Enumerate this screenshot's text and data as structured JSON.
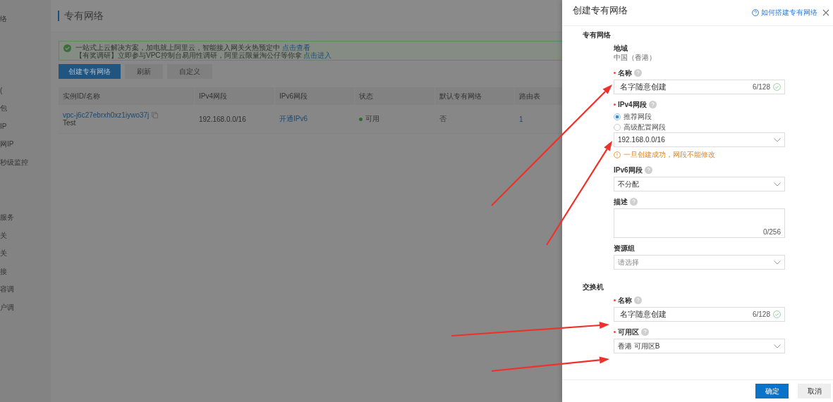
{
  "sidebar": {
    "items": [
      {
        "label": "络"
      },
      {
        "label": "("
      },
      {
        "label": "包"
      },
      {
        "label": "IP"
      },
      {
        "label": "网IP"
      },
      {
        "label": "秒级监控"
      },
      {
        "label": "服务"
      },
      {
        "label": "关"
      },
      {
        "label": "关"
      },
      {
        "label": "接"
      },
      {
        "label": "容调"
      },
      {
        "label": "户调"
      }
    ]
  },
  "page": {
    "title": "专有网络",
    "notices": [
      {
        "text": "一站式上云解决方案，加电就上阿里云，智能接入网关火热预定中",
        "link": "点击查看"
      },
      {
        "text": "【有奖调研】立即参与VPC控制台易用性调研，阿里云限量淘公仔等你拿",
        "link": "点击进入"
      }
    ],
    "buttons": [
      {
        "label": "创建专有网络",
        "kind": "primary"
      },
      {
        "label": "刷新",
        "kind": "default"
      },
      {
        "label": "自定义",
        "kind": "default"
      }
    ],
    "table": {
      "columns": [
        "实例ID/名称",
        "IPv4网段",
        "IPv6网段",
        "状态",
        "默认专有网络",
        "路由表"
      ],
      "rows": [
        {
          "id": "vpc-j6c27ebrxh0xz1iywo37j",
          "name": "Test",
          "ipv4": "192.168.0.0/16",
          "ipv6": "开通IPv6",
          "status": "可用",
          "default": "否",
          "route_tables": "1"
        }
      ]
    }
  },
  "drawer": {
    "title": "创建专有网络",
    "help_link": "如何搭建专有网络",
    "sections": [
      {
        "title": "专有网络",
        "fields": [
          {
            "kind": "static",
            "label": "地域",
            "value": "中国（香港）"
          },
          {
            "kind": "input",
            "label": "名称",
            "required": true,
            "help": true,
            "value": "名字随意创建",
            "counter": "6/128",
            "valid": true
          },
          {
            "kind": "radio",
            "label": "IPv4网段",
            "required": true,
            "help": true,
            "options": [
              {
                "label": "推荐网段",
                "selected": true
              },
              {
                "label": "高级配置网段",
                "selected": false
              }
            ],
            "value": "192.168.0.0/16",
            "warning": "一旦创建成功，网段不能修改"
          },
          {
            "kind": "select",
            "label": "IPv6网段",
            "required": false,
            "help": true,
            "value": "不分配"
          },
          {
            "kind": "textarea",
            "label": "描述",
            "required": false,
            "help": true,
            "counter": "0/256"
          },
          {
            "kind": "select",
            "label": "资源组",
            "required": false,
            "help": false,
            "placeholder": "请选择"
          }
        ]
      },
      {
        "title": "交换机",
        "fields": [
          {
            "kind": "input",
            "label": "名称",
            "required": true,
            "help": true,
            "value": "名字随意创建",
            "counter": "6/128",
            "valid": true
          },
          {
            "kind": "select",
            "label": "可用区",
            "required": true,
            "help": true,
            "value": "香港 可用区B"
          }
        ]
      }
    ],
    "buttons": [
      {
        "label": "确定",
        "kind": "primary"
      },
      {
        "label": "取消",
        "kind": "default"
      }
    ]
  }
}
